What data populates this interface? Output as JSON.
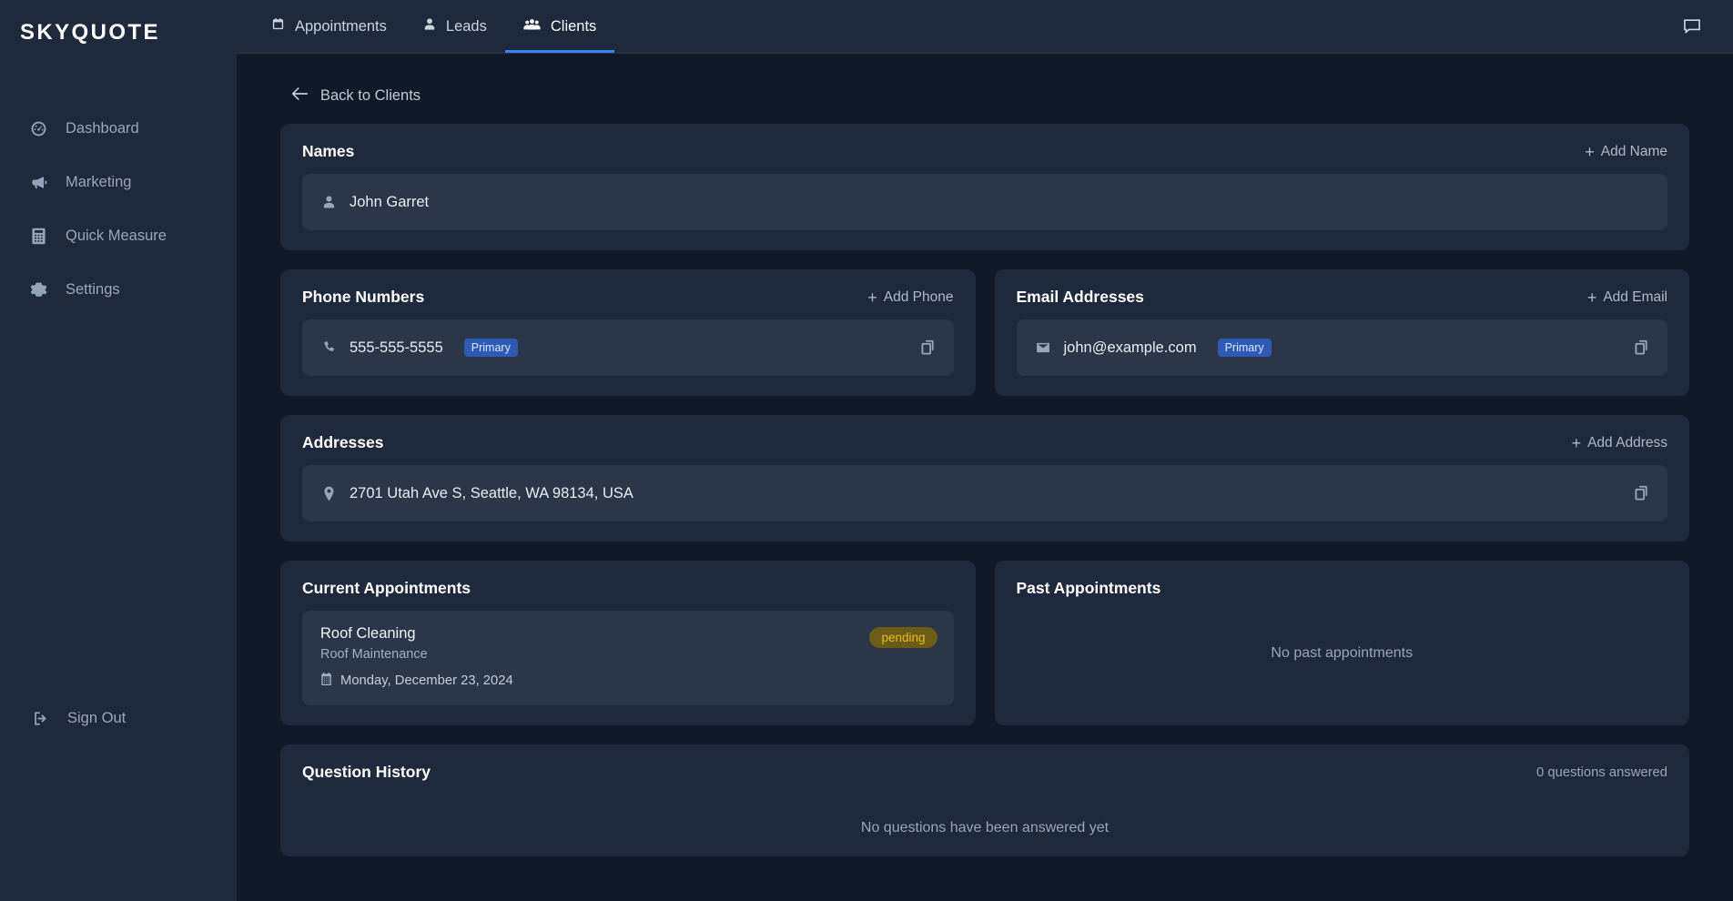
{
  "brand": {
    "name": "SKYQUOTE"
  },
  "sidebar": {
    "items": [
      {
        "label": "Dashboard",
        "icon": "gauge-icon"
      },
      {
        "label": "Marketing",
        "icon": "bullhorn-icon"
      },
      {
        "label": "Quick Measure",
        "icon": "calculator-icon"
      },
      {
        "label": "Settings",
        "icon": "gear-icon"
      }
    ],
    "sign_out": {
      "label": "Sign Out",
      "icon": "sign-out-icon"
    }
  },
  "topbar": {
    "tabs": [
      {
        "label": "Appointments",
        "icon": "calendar-icon",
        "active": false
      },
      {
        "label": "Leads",
        "icon": "user-icon",
        "active": false
      },
      {
        "label": "Clients",
        "icon": "users-icon",
        "active": true
      }
    ],
    "chat_icon": "chat-bubble-icon",
    "active_indicator_color": "#3b82f6"
  },
  "back_link": {
    "label": "Back to Clients",
    "icon": "arrow-left-icon"
  },
  "names_card": {
    "title": "Names",
    "add_label": "Add Name",
    "items": [
      {
        "value": "John Garret",
        "icon": "person-icon"
      }
    ]
  },
  "phones_card": {
    "title": "Phone Numbers",
    "add_label": "Add Phone",
    "items": [
      {
        "value": "555-555-5555",
        "badge": "Primary",
        "icon": "phone-icon",
        "copy_icon": "copy-icon"
      }
    ]
  },
  "emails_card": {
    "title": "Email Addresses",
    "add_label": "Add Email",
    "items": [
      {
        "value": "john@example.com",
        "badge": "Primary",
        "icon": "envelope-icon",
        "copy_icon": "copy-icon"
      }
    ]
  },
  "addresses_card": {
    "title": "Addresses",
    "add_label": "Add Address",
    "items": [
      {
        "value": "2701 Utah Ave S, Seattle, WA 98134, USA",
        "icon": "map-pin-icon",
        "copy_icon": "copy-icon"
      }
    ]
  },
  "current_appointments": {
    "title": "Current Appointments",
    "items": [
      {
        "name": "Roof Cleaning",
        "service": "Roof Maintenance",
        "date": "Monday, December 23, 2024",
        "status": "pending",
        "status_color": "#e8bb22",
        "date_icon": "calendar-icon"
      }
    ]
  },
  "past_appointments": {
    "title": "Past Appointments",
    "empty_message": "No past appointments"
  },
  "question_history": {
    "title": "Question History",
    "count_label": "0 questions answered",
    "empty_message": "No questions have been answered yet"
  },
  "colors": {
    "sidebar_bg": "#1e293b",
    "page_bg": "#111827",
    "card_bg": "#1e293b",
    "row_bg": "#2b3648",
    "accent": "#3b82f6",
    "badge_primary_bg": "#2f5bb7"
  }
}
